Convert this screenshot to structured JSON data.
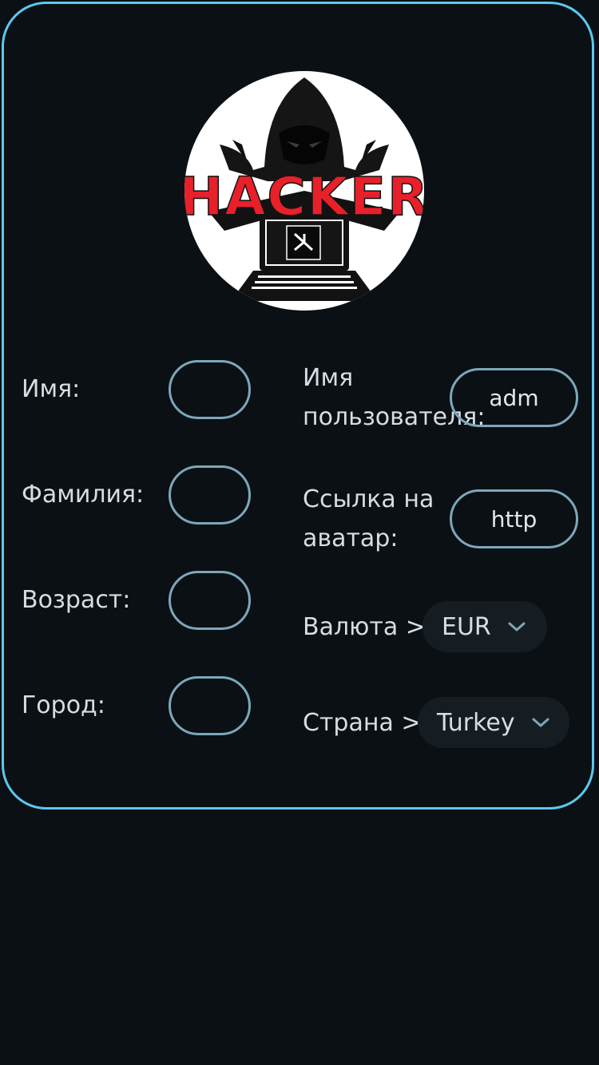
{
  "form": {
    "first_name_label": "Имя:",
    "first_name_value": "",
    "last_name_label": "Фамилия:",
    "last_name_value": "",
    "age_label": "Возраст:",
    "age_value": "",
    "city_label": "Город:",
    "city_value": "",
    "username_label_line1": "Имя",
    "username_label_line2": "пользователя:",
    "username_value": "adm",
    "avatar_link_label_line1": "Ссылка на",
    "avatar_link_label_line2": "аватар:",
    "avatar_link_value": "http",
    "currency_label": "Валюта >",
    "currency_value": "EUR",
    "country_label": "Страна >",
    "country_value": "Turkey"
  },
  "avatar": {
    "logo_text": "HACKER",
    "icon": "hacker-logo"
  },
  "colors": {
    "background": "#0b1014",
    "card_border": "#5cc8ee",
    "field_border": "#7ca7b9",
    "dropdown_bg": "#161d22",
    "logo_red": "#e8202a"
  },
  "icons": {
    "dropdown": "chevron-down-icon"
  }
}
